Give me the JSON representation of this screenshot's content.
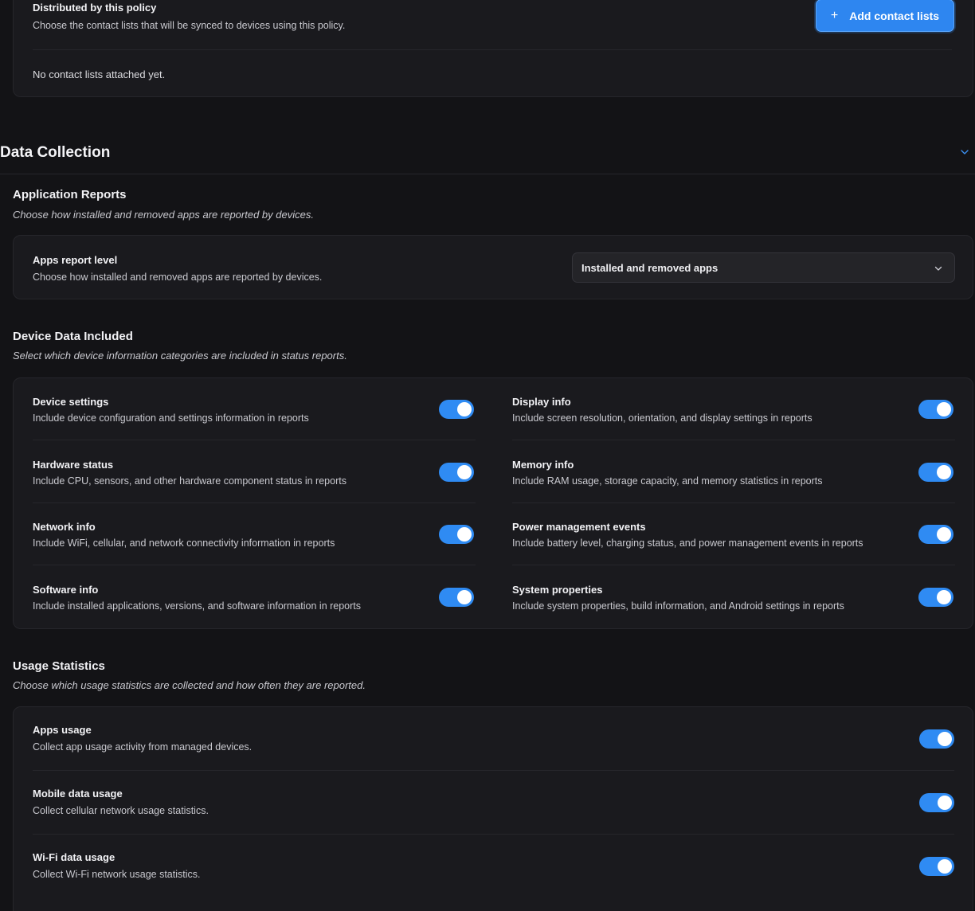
{
  "contacts": {
    "title": "Distributed by this policy",
    "description": "Choose the contact lists that will be synced to devices using this policy.",
    "add_button_label": "Add contact lists",
    "add_button_icon": "plus-icon",
    "empty_message": "No contact lists attached yet."
  },
  "data_collection": {
    "title": "Data Collection",
    "collapse_icon": "chevron-down-icon",
    "application_reports": {
      "title": "Application Reports",
      "description": "Choose how installed and removed apps are reported by devices.",
      "apps_report_level": {
        "label": "Apps report level",
        "description": "Choose how installed and removed apps are reported by devices.",
        "selected_value": "Installed and removed apps"
      }
    },
    "device_data": {
      "title": "Device Data Included",
      "description": "Select which device information categories are included in status reports.",
      "items": [
        {
          "label": "Device settings",
          "description": "Include device configuration and settings information in reports",
          "enabled": true
        },
        {
          "label": "Display info",
          "description": "Include screen resolution, orientation, and display settings in reports",
          "enabled": true
        },
        {
          "label": "Hardware status",
          "description": "Include CPU, sensors, and other hardware component status in reports",
          "enabled": true
        },
        {
          "label": "Memory info",
          "description": "Include RAM usage, storage capacity, and memory statistics in reports",
          "enabled": true
        },
        {
          "label": "Network info",
          "description": "Include WiFi, cellular, and network connectivity information in reports",
          "enabled": true
        },
        {
          "label": "Power management events",
          "description": "Include battery level, charging status, and power management events in reports",
          "enabled": true
        },
        {
          "label": "Software info",
          "description": "Include installed applications, versions, and software information in reports",
          "enabled": true
        },
        {
          "label": "System properties",
          "description": "Include system properties, build information, and Android settings in reports",
          "enabled": true
        }
      ]
    },
    "usage_statistics": {
      "title": "Usage Statistics",
      "description": "Choose which usage statistics are collected and how often they are reported.",
      "items": [
        {
          "label": "Apps usage",
          "description": "Collect app usage activity from managed devices.",
          "enabled": true
        },
        {
          "label": "Mobile data usage",
          "description": "Collect cellular network usage statistics.",
          "enabled": true
        },
        {
          "label": "Wi-Fi data usage",
          "description": "Collect Wi-Fi network usage statistics.",
          "enabled": true
        }
      ]
    }
  },
  "colors": {
    "background": "#131316",
    "card": "#1a1a1e",
    "accent": "#2e86f0",
    "toggle_on": "#2f8bf3"
  }
}
